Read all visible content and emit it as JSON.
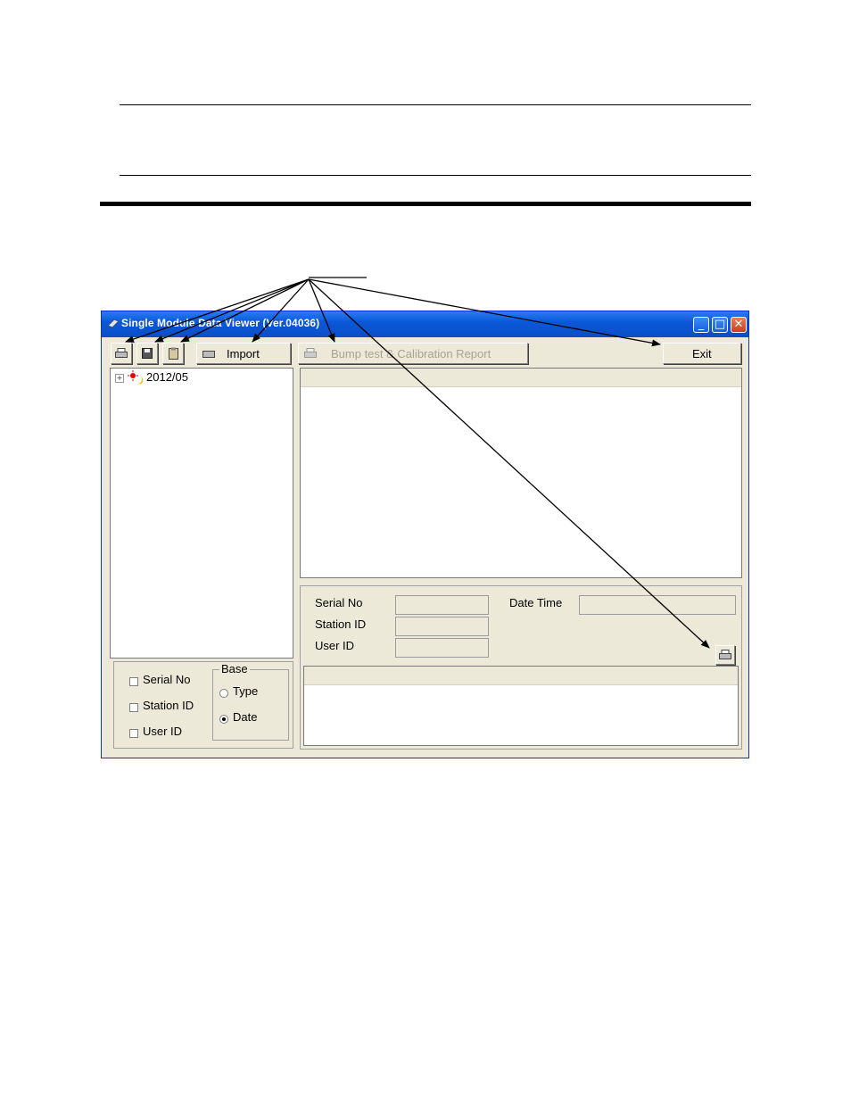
{
  "window": {
    "title": "Single Module Data Viewer (Ver.04036)",
    "minimize_glyph": "_",
    "maximize_glyph": "□",
    "close_glyph": "✕"
  },
  "toolbar": {
    "import_label": "Import",
    "report_label": "Bump test & Calibration Report",
    "exit_label": "Exit"
  },
  "tree": {
    "expander": "+",
    "root_label": "2012/05"
  },
  "filters": {
    "serial_no": "Serial No",
    "station_id": "Station ID",
    "user_id": "User ID",
    "base_label": "Base",
    "type_label": "Type",
    "date_label": "Date"
  },
  "details": {
    "serial_no": "Serial No",
    "station_id": "Station ID",
    "user_id": "User ID",
    "date_time": "Date Time"
  },
  "icons": {
    "printer": "printer-icon",
    "save": "save-icon",
    "clipboard": "clipboard-icon",
    "import": "import-icon",
    "tree_node": "calendar-node-icon"
  },
  "colors": {
    "titlebar": "#0a58d8",
    "window_bg": "#ece9d8",
    "close_button": "#c8401b"
  }
}
